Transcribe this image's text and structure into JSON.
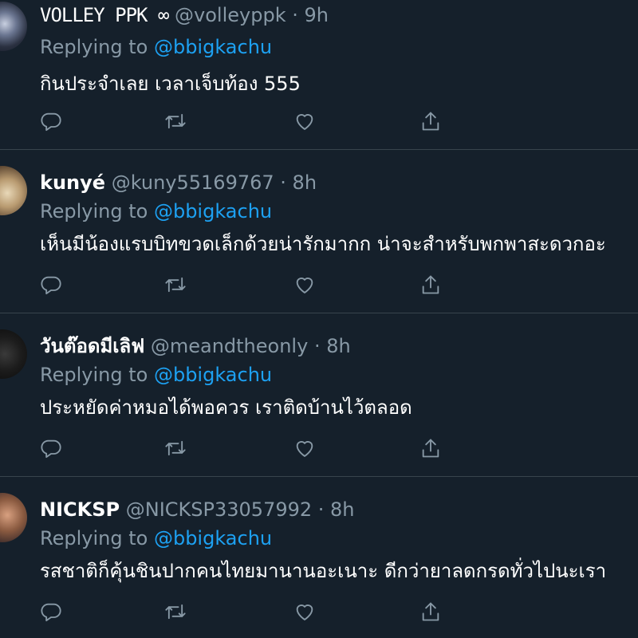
{
  "replying_label": "Replying to",
  "tweets": [
    {
      "name": "VOLLEY PPK ∞",
      "handle": "@volleyppk",
      "time": "· 9h",
      "reply_to": "@bbigkachu",
      "text": "กินประจำเลย เวลาเจ็บท้อง 555"
    },
    {
      "name": "kunyé",
      "handle": "@kuny55169767",
      "time": "· 8h",
      "reply_to": "@bbigkachu",
      "text": "เห็นมีน้องแรบบิทขวดเล็กด้วยน่ารักมากก น่าจะสำหรับพกพาสะดวกอะ"
    },
    {
      "name": "วันต๊อดมีเลิฟ",
      "handle": "@meandtheonly",
      "time": "· 8h",
      "reply_to": "@bbigkachu",
      "text": "ประหยัดค่าหมอได้พอควร เราติดบ้านไว้ตลอด"
    },
    {
      "name": "NICKSP",
      "handle": "@NICKSP33057992",
      "time": "· 8h",
      "reply_to": "@bbigkachu",
      "text": "รสชาติก็คุ้นชินปากคนไทยมานานอะเนาะ ดีกว่ายาลดกรดทั่วไปนะเรา"
    }
  ],
  "icons": {
    "reply": "reply-icon",
    "retweet": "retweet-icon",
    "like": "like-icon",
    "share": "share-icon"
  },
  "colors": {
    "background": "#15202b",
    "divider": "#38444d",
    "text": "#ffffff",
    "secondary": "#8899a6",
    "accent": "#1da1f2"
  }
}
